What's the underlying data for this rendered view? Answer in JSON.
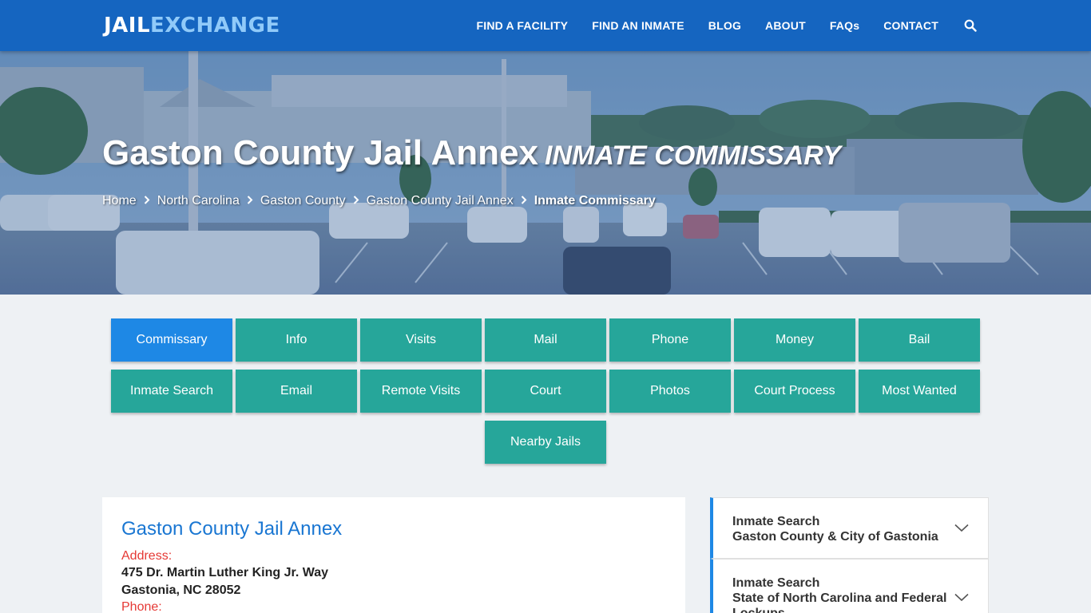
{
  "brand": {
    "part1": "JAIL",
    "part2": "EXCHANGE"
  },
  "nav": {
    "items": [
      "FIND A FACILITY",
      "FIND AN INMATE",
      "BLOG",
      "ABOUT",
      "FAQs",
      "CONTACT"
    ],
    "search_icon": "search-icon"
  },
  "hero": {
    "title": "Gaston County Jail Annex",
    "subtitle": "Inmate Commissary",
    "breadcrumb": [
      "Home",
      "North Carolina",
      "Gaston County",
      "Gaston County Jail Annex",
      "Inmate Commissary"
    ]
  },
  "tabs": {
    "row1": [
      "Commissary",
      "Info",
      "Visits",
      "Mail",
      "Phone",
      "Money",
      "Bail"
    ],
    "row2": [
      "Inmate Search",
      "Email",
      "Remote Visits",
      "Court",
      "Photos",
      "Court Process",
      "Most Wanted"
    ],
    "row3": [
      "Nearby Jails"
    ],
    "active": "Commissary"
  },
  "card": {
    "title": "Gaston County Jail Annex",
    "address_label": "Address:",
    "address_line1": "475 Dr. Martin Luther King Jr. Way",
    "address_line2": "Gastonia, NC 28052",
    "phone_label": "Phone:"
  },
  "sidebar": {
    "items": [
      {
        "line1": "Inmate Search",
        "line2": "Gaston County & City of Gastonia",
        "line3": ""
      },
      {
        "line1": "Inmate Search",
        "line2": "State of North Carolina and Federal",
        "line3": "Lockups"
      }
    ]
  },
  "colors": {
    "header": "#1565c0",
    "tab": "#26a69a",
    "tab_active": "#1e88e5",
    "card_title": "#1976d2",
    "label_red": "#e53935"
  }
}
